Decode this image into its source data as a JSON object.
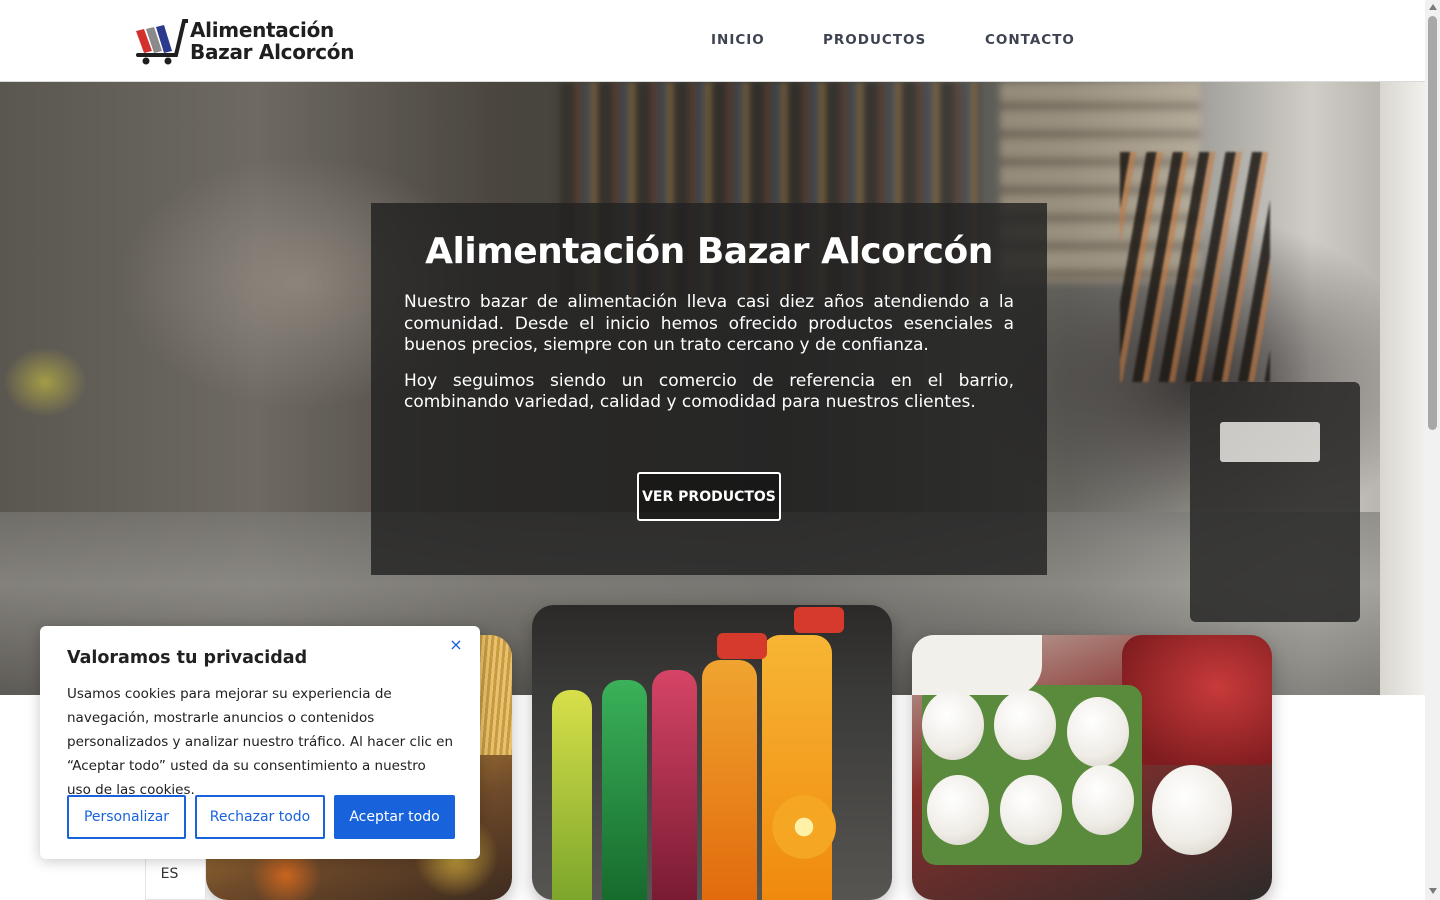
{
  "brand": {
    "line1": "Alimentación",
    "line2": "Bazar Alcorcón",
    "colors": [
      "#d2312b",
      "#2b3a8c",
      "#8a8a8a",
      "#1f1f1f"
    ]
  },
  "nav": {
    "items": [
      {
        "label": "INICIO"
      },
      {
        "label": "PRODUCTOS"
      },
      {
        "label": "CONTACTO"
      }
    ]
  },
  "hero": {
    "title": "Alimentación Bazar Alcorcón",
    "paragraph1": "Nuestro bazar de alimentación lleva casi diez años atendiendo a la comunidad. Desde el inicio hemos ofrecido productos esenciales a buenos precios, siempre con un trato cercano y de confianza.",
    "paragraph2": "Hoy seguimos siendo un comercio de referencia en el barrio, combinando variedad, calidad y comodidad para nuestros clientes.",
    "button_label": "VER PRODUCTOS"
  },
  "language": {
    "current": "ES"
  },
  "cookie_banner": {
    "title": "Valoramos tu privacidad",
    "body": "Usamos cookies para mejorar su experiencia de navegación, mostrarle anuncios o contenidos personalizados y analizar nuestro tráfico. Al hacer clic en “Aceptar todo” usted da su consentimiento a nuestro uso de las cookies.",
    "close_icon": "×",
    "buttons": {
      "customize": "Personalizar",
      "reject": "Rechazar todo",
      "accept": "Aceptar todo"
    },
    "accent_color": "#1863dc"
  }
}
